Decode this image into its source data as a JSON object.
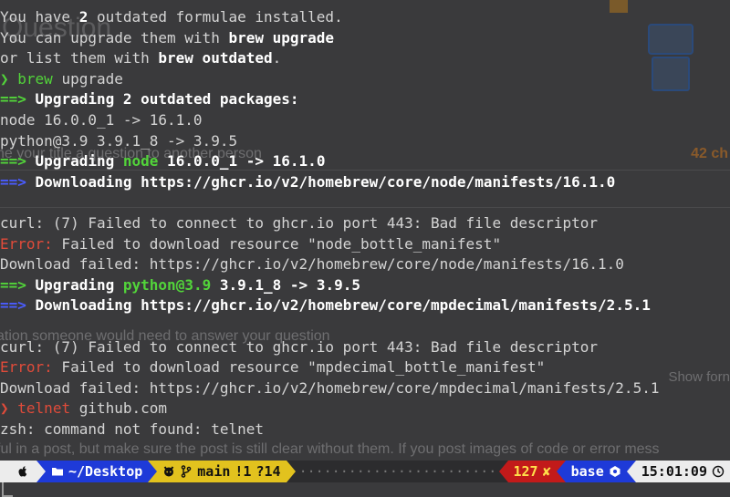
{
  "background": {
    "title": "Question",
    "hint_top": "he your title a question to another person",
    "char_count": "42 ch",
    "hint_mid": "ation someone would need to answer your question",
    "show_formatting": "Show forn",
    "footer_text": "ful in a post, but make sure the post is still clear without them. If you post images of code or error mess"
  },
  "terminal": {
    "outdated": {
      "pre": "You have ",
      "count": "2",
      "post": " outdated formulae installed."
    },
    "upgrade_hint": {
      "pre": "You can upgrade them with ",
      "cmd": "brew upgrade"
    },
    "outdated_hint": {
      "pre": "or list them with ",
      "cmd": "brew outdated",
      "post": "."
    },
    "prompt_symbol": "❯",
    "command1": "brew",
    "command1_args": " upgrade",
    "arrow": "==>",
    "upgrading_header": "Upgrading 2 outdated packages:",
    "pkg_node": "node 16.0.0_1 -> 16.1.0",
    "pkg_python": "python@3.9 3.9.1_8 -> 3.9.5",
    "upgrading_word": "Upgrading",
    "node_name": "node",
    "node_versions": " 16.0.0_1 -> 16.1.0",
    "node_download": "Downloading https://ghcr.io/v2/homebrew/core/node/manifests/16.1.0",
    "curl_error": "curl: (7) Failed to connect to ghcr.io port 443: Bad file descriptor",
    "error_label": "Error:",
    "node_error_msg": " Failed to download resource \"node_bottle_manifest\"",
    "node_failed": "Download failed: https://ghcr.io/v2/homebrew/core/node/manifests/16.1.0",
    "python_name": "python@3.9",
    "python_versions": " 3.9.1_8 -> 3.9.5",
    "mpdecimal_download": "Downloading https://ghcr.io/v2/homebrew/core/mpdecimal/manifests/2.5.1",
    "mpdecimal_error_msg": " Failed to download resource \"mpdecimal_bottle_manifest\"",
    "mpdecimal_failed": "Download failed: https://ghcr.io/v2/homebrew/core/mpdecimal/manifests/2.5.1",
    "command2": "telnet",
    "command2_args": " github.com",
    "not_found": "zsh: command not found: telnet"
  },
  "statusbar": {
    "apple_icon": "apple-icon",
    "directory": "~/Desktop",
    "git_branch": "main",
    "git_modified": "!1",
    "git_untracked": "?14",
    "dots": "·····························································",
    "exit_code": "127",
    "exit_mark": "✘",
    "env": "base",
    "time": "15:01:09",
    "colors": {
      "apple": "#ececec",
      "dir": "#1e3ad8",
      "git": "#e2c21e",
      "error": "#c21a1a",
      "env": "#1e3ad8",
      "time": "#ececec"
    }
  }
}
